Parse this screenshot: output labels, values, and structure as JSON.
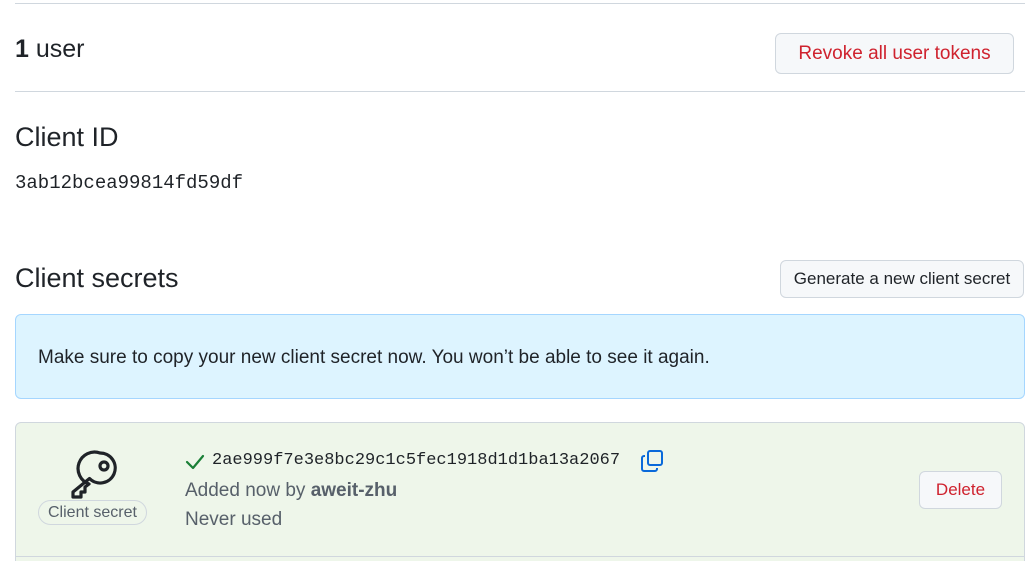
{
  "users": {
    "count": "1",
    "unit": "user",
    "revoke_label": "Revoke all user tokens"
  },
  "client_id": {
    "title": "Client ID",
    "value": "3ab12bcea99814fd59df"
  },
  "client_secrets": {
    "title": "Client secrets",
    "generate_label": "Generate a new client secret",
    "flash_message": "Make sure to copy your new client secret now. You won’t be able to see it again.",
    "secret": {
      "label": "Client secret",
      "value": "2ae999f7e3e8bc29c1c5fec1918d1d1ba13a2067",
      "added_prefix": "Added now by",
      "added_by": "aweit-zhu",
      "usage": "Never used",
      "delete_label": "Delete",
      "icons": {
        "key": "key-icon",
        "check": "check-icon",
        "copy": "copy-icon"
      }
    }
  },
  "colors": {
    "danger": "#cf222e",
    "info_bg": "#ddf4ff",
    "info_border": "#a5d6ff",
    "success_bg": "#eef6ea",
    "success_check": "#1a7f37",
    "copy_icon": "#0969da",
    "muted": "#57606a"
  }
}
